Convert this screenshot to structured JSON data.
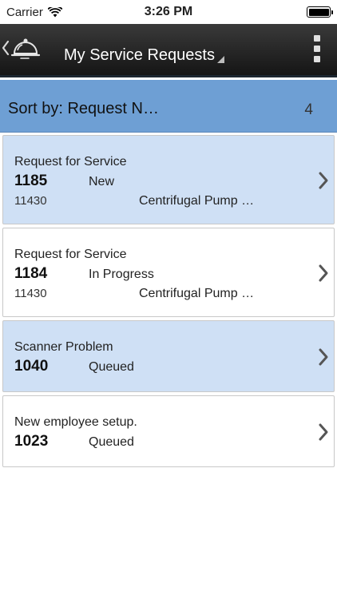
{
  "status_bar": {
    "carrier": "Carrier",
    "time": "3:26 PM"
  },
  "nav": {
    "title": "My Service Requests",
    "back_icon": "chevron-left-icon",
    "app_icon": "service-bell-icon",
    "menu_icon": "more-vertical-icon"
  },
  "sort": {
    "label": "Sort by: Request N…",
    "count": "4"
  },
  "colors": {
    "nav_bg": "#1e1e1e",
    "sort_bar_bg": "#6e9fd4",
    "row_alt_bg": "#cfe0f5",
    "row_bg": "#ffffff"
  },
  "requests": [
    {
      "title": "Request for Service",
      "id": "1185",
      "status": "New",
      "sub": "11430",
      "asset": "Centrifugal Pump …"
    },
    {
      "title": "Request for Service",
      "id": "1184",
      "status": "In Progress",
      "sub": "11430",
      "asset": "Centrifugal Pump …"
    },
    {
      "title": "Scanner Problem",
      "id": "1040",
      "status": "Queued"
    },
    {
      "title": "New employee setup.",
      "id": "1023",
      "status": "Queued"
    }
  ]
}
